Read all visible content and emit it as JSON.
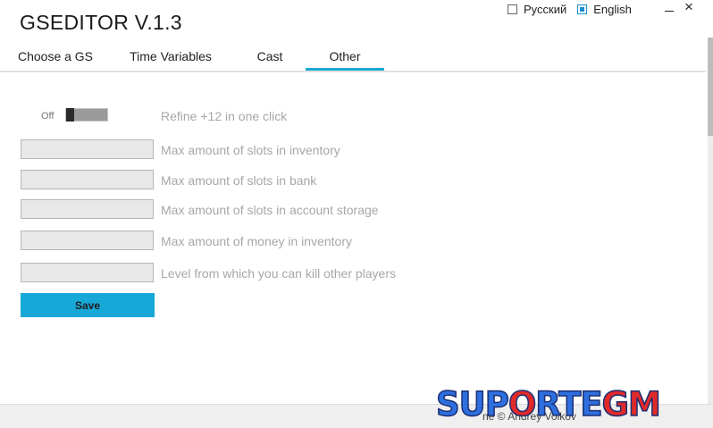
{
  "app": {
    "title": "GSEDITOR V.1.3"
  },
  "languages": [
    {
      "label": "Русский",
      "checked": false
    },
    {
      "label": "English",
      "checked": true
    }
  ],
  "window_controls": {
    "minimize_icon": "minimize-icon",
    "close_symbol": "×"
  },
  "tabs": [
    {
      "label": "Choose a GS",
      "active": false
    },
    {
      "label": "Time Variables",
      "active": false
    },
    {
      "label": "Cast",
      "active": false
    },
    {
      "label": "Other",
      "active": true
    }
  ],
  "toggle": {
    "state_label": "Off",
    "on": false,
    "description": "Refine +12 in one click"
  },
  "fields": [
    {
      "label": "Max amount of slots in inventory",
      "value": ""
    },
    {
      "label": "Max amount of slots in bank",
      "value": ""
    },
    {
      "label": "Max amount of slots in account storage",
      "value": ""
    },
    {
      "label": "Max amount of money in inventory",
      "value": ""
    },
    {
      "label": "Level from which you can kill other players",
      "value": ""
    }
  ],
  "save_label": "Save",
  "status_bar": {
    "partial_text": "ne          © Andrey Volkov"
  },
  "watermark": {
    "part1": "SUP",
    "part2": "O",
    "part3": "RTE",
    "part4": "GM"
  },
  "colors": {
    "accent": "#18a8d8",
    "watermark_blue": "#2e6fe0",
    "watermark_red": "#e02a2a"
  }
}
